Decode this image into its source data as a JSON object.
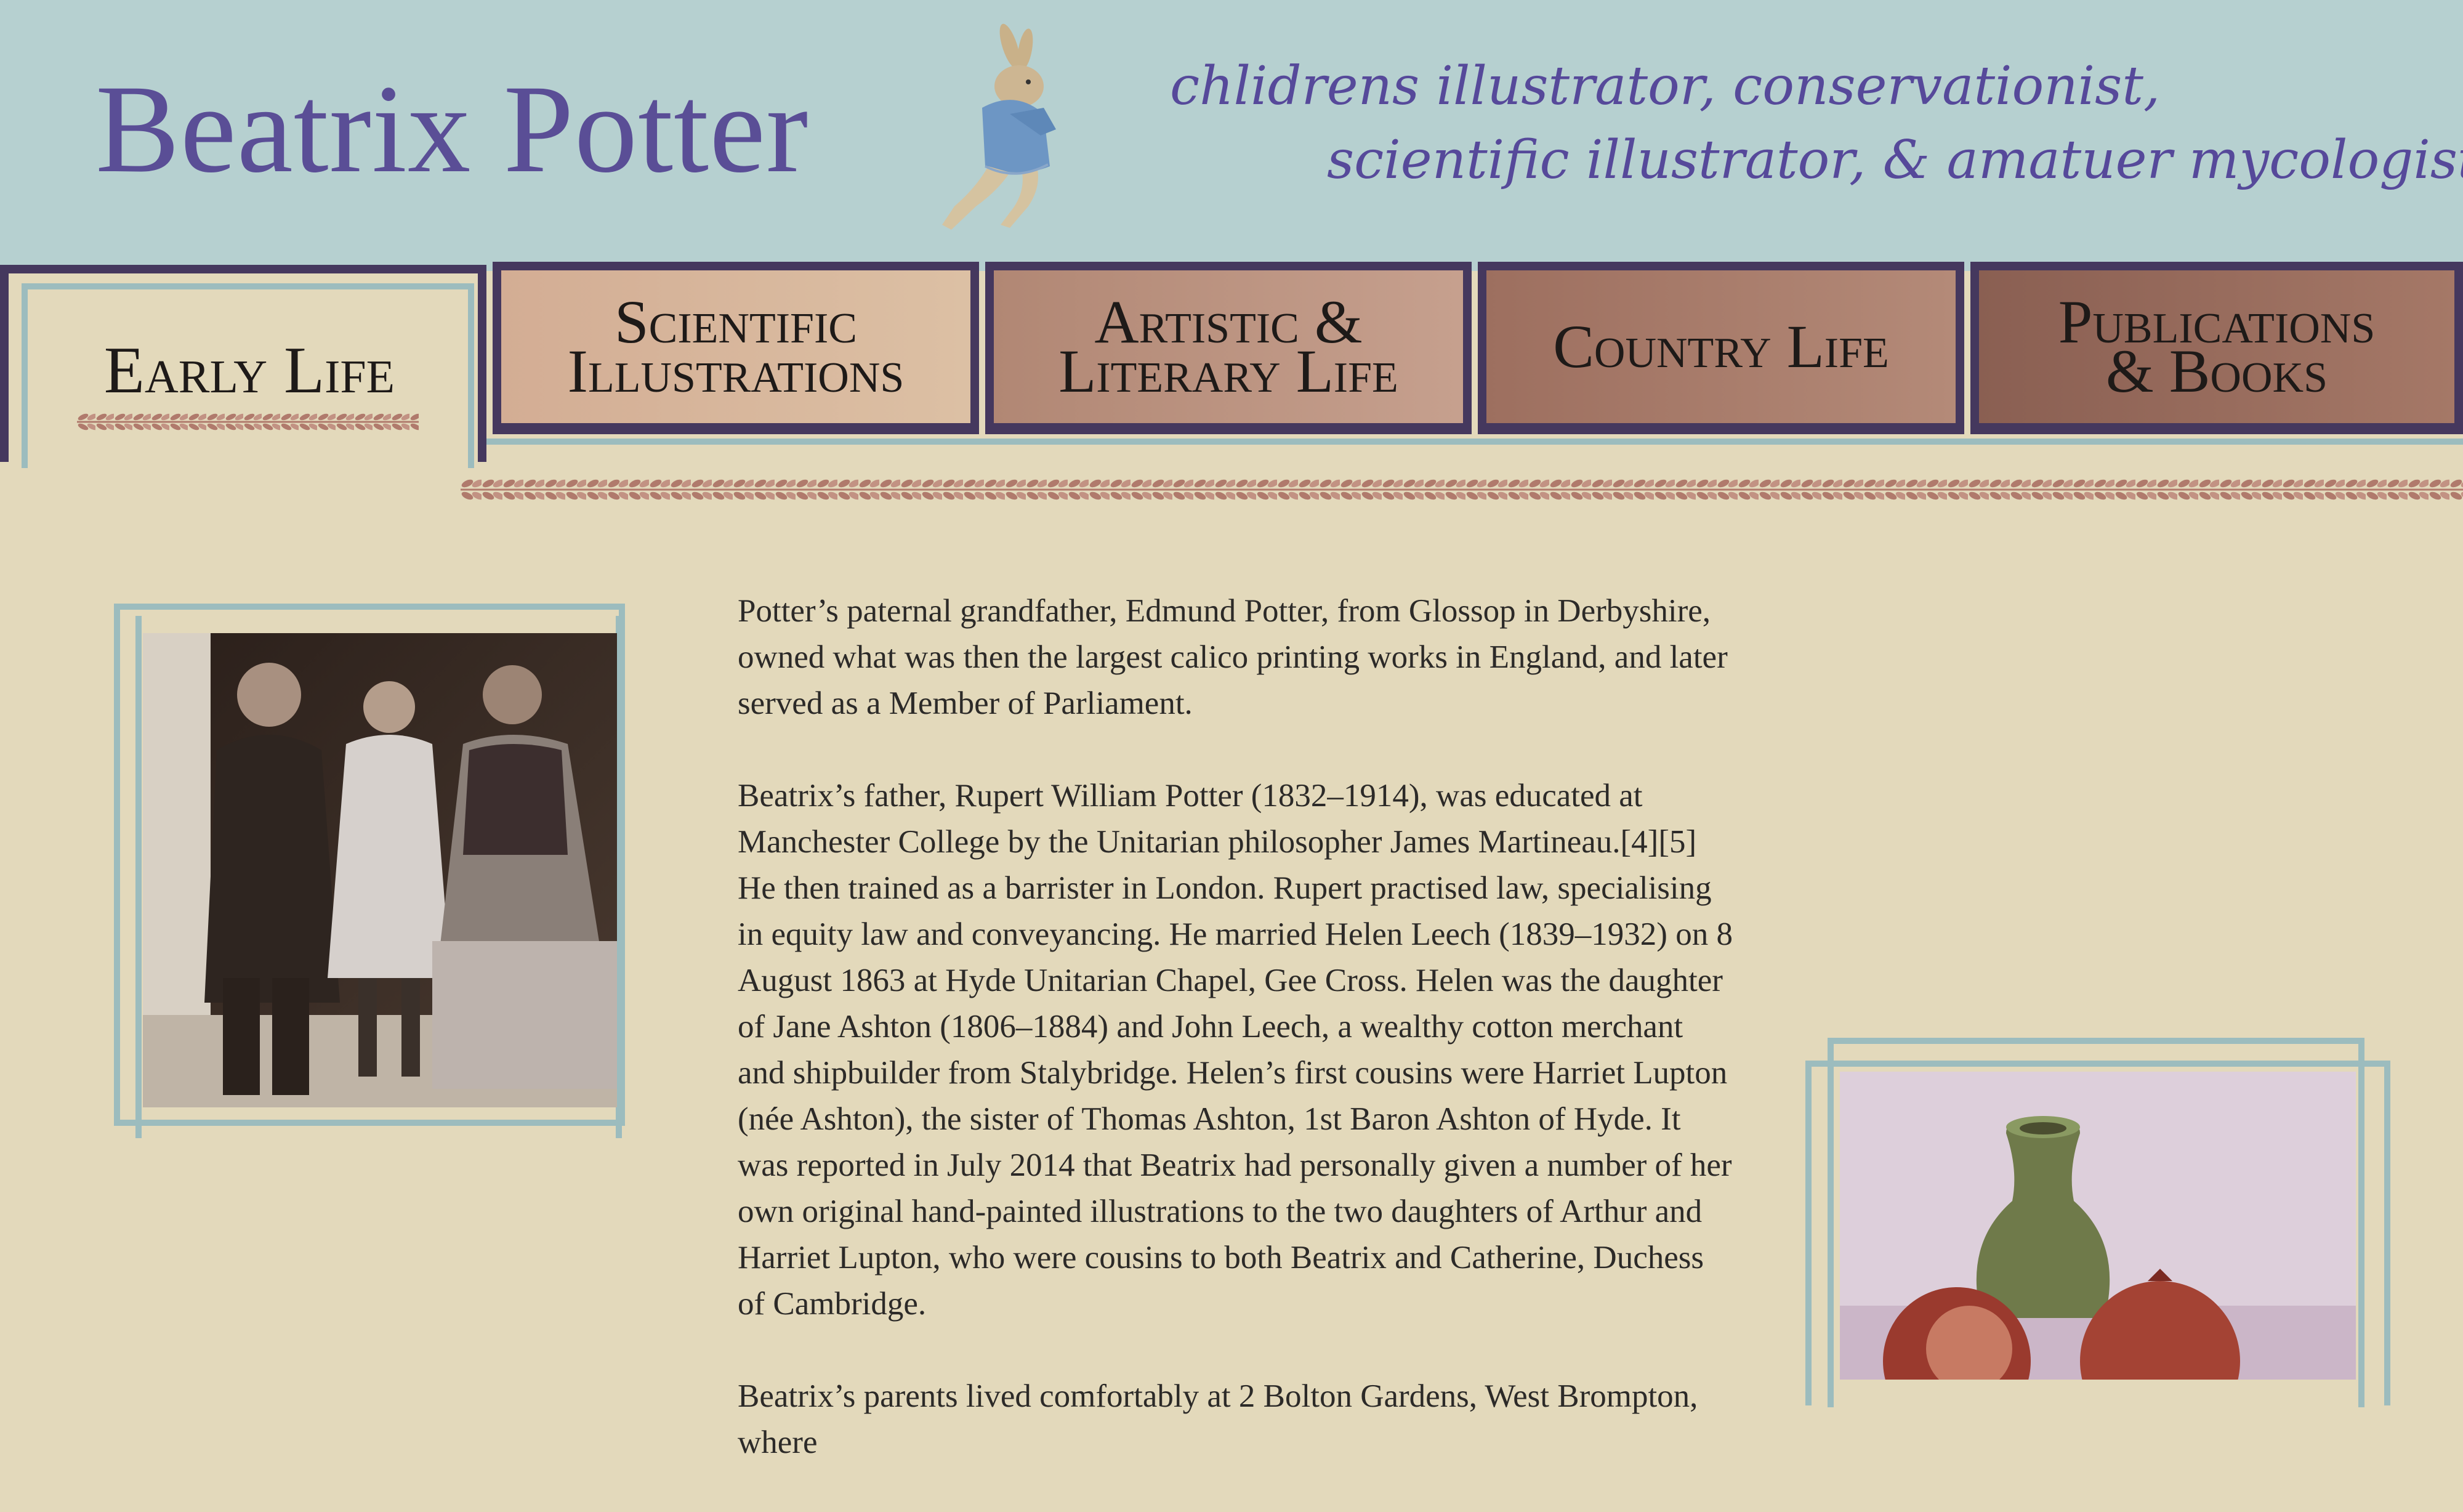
{
  "site": {
    "title": "Beatrix Potter",
    "tagline_line1": "chlidrens illustrator,  conservationist,",
    "tagline_line2": "scientific illustrator,   &   amatuer mycologist.,"
  },
  "nav": {
    "active": "Early Life",
    "tabs": [
      "Scientific\nIllustrations",
      "Artistic &\nLiterary Life",
      "Country Life",
      "Publications\n& Books"
    ]
  },
  "article": {
    "paragraphs": [
      "Potter’s paternal grandfather, Edmund Potter, from Glossop in Derbyshire, owned what was then the largest calico printing works in England, and later served as a Member of Parliament.",
      "Beatrix’s father, Rupert William Potter (1832–1914), was educated at Manchester College by the Unitarian philosopher James Martineau.[4][5] He then trained as a barrister in London. Rupert practised law, specialising in equity law and conveyancing. He married Helen Leech (1839–1932) on 8 August 1863 at Hyde Unitarian Chapel, Gee Cross. Helen was the daughter of Jane Ashton (1806–1884) and John Leech, a wealthy cotton merchant and shipbuilder from Stalybridge. Helen’s first cousins were Harriet Lupton (née Ashton), the sister of Thomas Ashton, 1st Baron Ashton of Hyde. It was reported in July 2014 that Beatrix had personally given a number of her own original hand-painted illustrations to the two daughters of Arthur and Harriet Lupton, who were cousins to both Beatrix and Catherine, Duchess of Cambridge.",
      "Beatrix’s parents lived comfortably at 2 Bolton Gardens, West Brompton, where"
    ]
  },
  "colors": {
    "header_bg": "#b6d0d0",
    "page_bg": "#e3d9bb",
    "title": "#5a4e96",
    "nav_border": "#45385e",
    "frame": "#9cbcbe",
    "laurel": "#b07a6c"
  },
  "icons": {
    "mascot": "peter-rabbit-illustration",
    "divider": "laurel-garland"
  }
}
